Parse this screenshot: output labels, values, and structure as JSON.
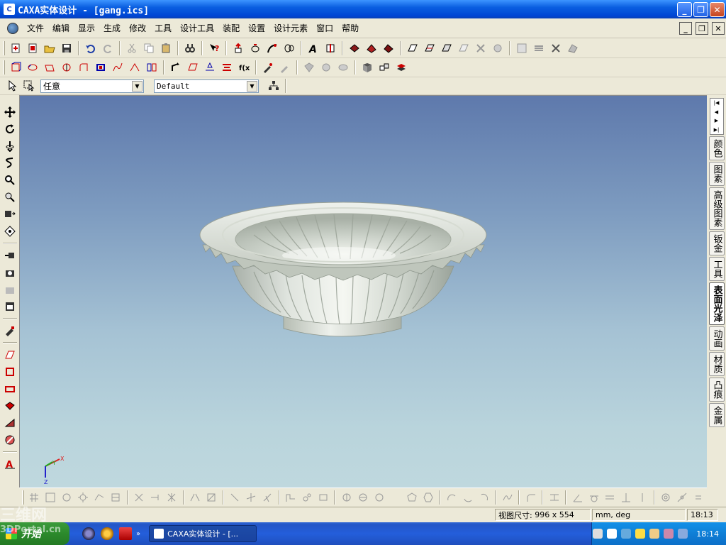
{
  "window": {
    "title": "CAXA实体设计 - [gang.ics]"
  },
  "menu": {
    "items": [
      "文件",
      "编辑",
      "显示",
      "生成",
      "修改",
      "工具",
      "设计工具",
      "装配",
      "设置",
      "设计元素",
      "窗口",
      "帮助"
    ]
  },
  "toolbar3": {
    "select_value": "任意",
    "style_value": "Default"
  },
  "right_tabs": [
    "颜色",
    "图素",
    "高级图素",
    "钣金",
    "工具",
    "表面光泽",
    "动画",
    "材质",
    "凸痕",
    "金属"
  ],
  "active_tab": "表面光泽",
  "status": {
    "label": "视图尺寸:",
    "width": "996",
    "x": "x",
    "height": "554",
    "units": "mm, deg",
    "time": "18:13"
  },
  "taskbar": {
    "start": "开始",
    "task_label": "CAXA实体设计 - [...",
    "clock": "18:14"
  },
  "axes": {
    "x": "X",
    "y": "Y",
    "z": "Z"
  },
  "watermark": {
    "line1": "三维网",
    "line2": "3DPortal.cn"
  }
}
